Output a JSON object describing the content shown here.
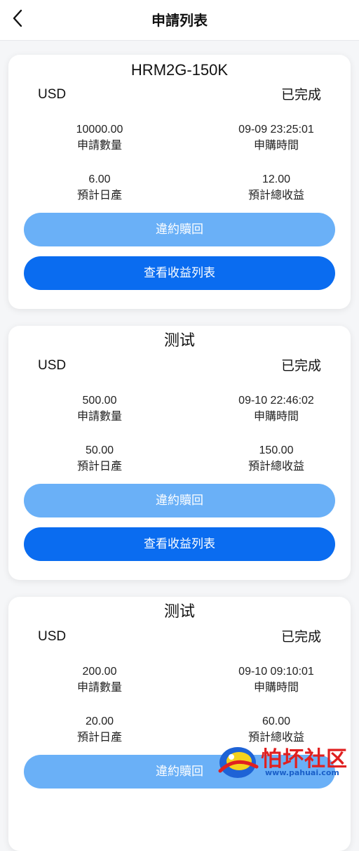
{
  "header": {
    "title": "申請列表",
    "back_icon": "chevron-left-icon"
  },
  "labels": {
    "amount": "申請數量",
    "purchase_time": "申購時間",
    "daily_yield": "預計日產",
    "total_yield": "預計總收益",
    "redeem_button": "違約贖回",
    "view_button": "查看收益列表"
  },
  "orders": [
    {
      "name": "HRM2G-150K",
      "currency": "USD",
      "status": "已完成",
      "amount": "10000.00",
      "purchase_time": "09-09 23:25:01",
      "daily_yield": "6.00",
      "total_yield": "12.00"
    },
    {
      "name": "测试",
      "currency": "USD",
      "status": "已完成",
      "amount": "500.00",
      "purchase_time": "09-10 22:46:02",
      "daily_yield": "50.00",
      "total_yield": "150.00"
    },
    {
      "name": "测试",
      "currency": "USD",
      "status": "已完成",
      "amount": "200.00",
      "purchase_time": "09-10 09:10:01",
      "daily_yield": "20.00",
      "total_yield": "60.00"
    }
  ],
  "watermark": {
    "text": "怕坏社区",
    "url": "www.pahuai.com"
  },
  "colors": {
    "primary": "#0a6cf0",
    "primary_light": "#6ab0f7",
    "background": "#f5f6f8"
  }
}
